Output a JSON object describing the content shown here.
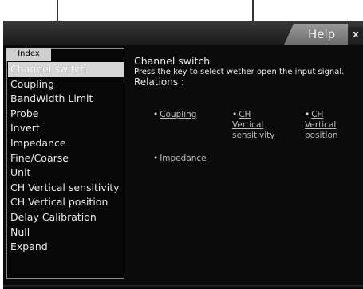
{
  "window": {
    "title_tab": "Help",
    "close_glyph": "x"
  },
  "index": {
    "tab_label": "Index",
    "items": [
      {
        "label": "Channel switch",
        "selected": true
      },
      {
        "label": "Coupling"
      },
      {
        "label": "BandWidth Limit"
      },
      {
        "label": "Probe"
      },
      {
        "label": "Invert"
      },
      {
        "label": "Impedance"
      },
      {
        "label": "Fine/Coarse"
      },
      {
        "label": "Unit"
      },
      {
        "label": "CH Vertical sensitivity"
      },
      {
        "label": "CH Vertical position"
      },
      {
        "label": "Delay Calibration"
      },
      {
        "label": "Null"
      },
      {
        "label": "Expand"
      }
    ]
  },
  "content": {
    "title": "Channel switch",
    "description": "Press the key to select wether open the input signal.",
    "relations_label": "Relations :",
    "relations": [
      {
        "label": "Coupling"
      },
      {
        "label": "CH Vertical sensitivity"
      },
      {
        "label": "CH Vertical position"
      },
      {
        "label": "Impedance"
      }
    ]
  },
  "colors": {
    "background": "#0b0b0b",
    "selected_highlight": "#d6d6d6",
    "text": "#ececec",
    "link": "#bcbcbc"
  }
}
